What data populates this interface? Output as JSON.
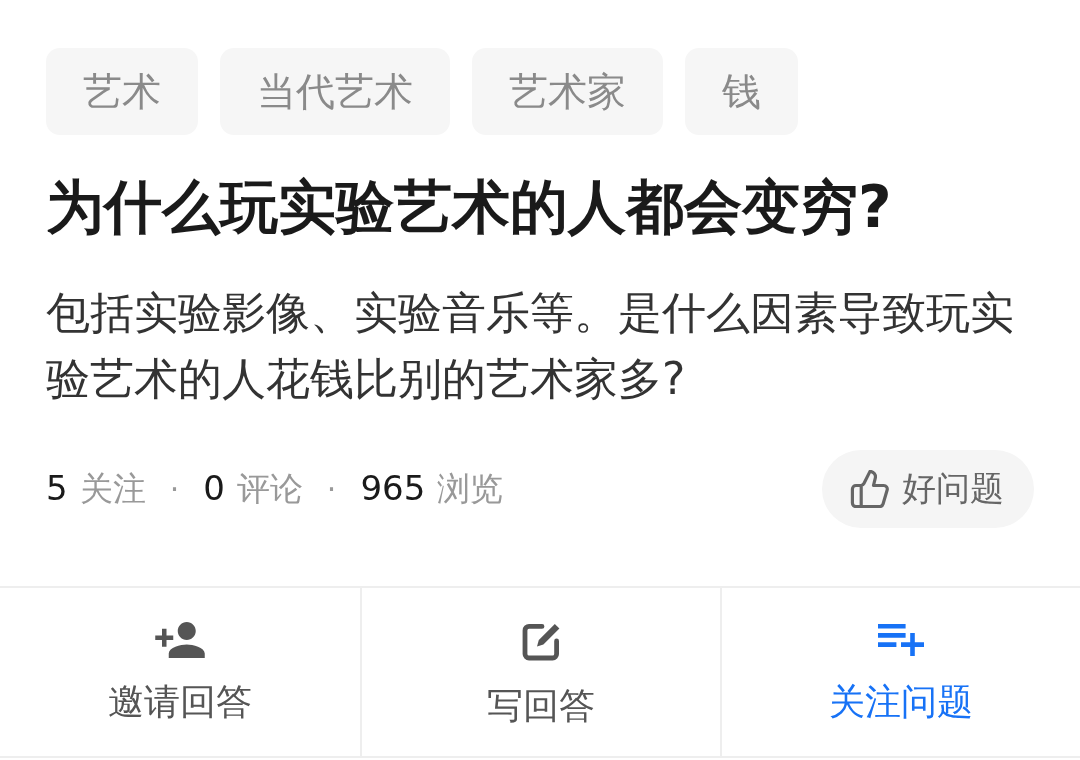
{
  "tags": [
    {
      "label": "艺术"
    },
    {
      "label": "当代艺术"
    },
    {
      "label": "艺术家"
    },
    {
      "label": "钱"
    }
  ],
  "question": {
    "title": "为什么玩实验艺术的人都会变穷?",
    "description": "包括实验影像、实验音乐等。是什么因素导致玩实验艺术的人花钱比别的艺术家多?"
  },
  "stats": [
    {
      "count": "5",
      "label": "关注"
    },
    {
      "count": "0",
      "label": "评论"
    },
    {
      "count": "965",
      "label": "浏览"
    }
  ],
  "separators": [
    "·",
    "·"
  ],
  "good_question_button": {
    "label": "好问题"
  },
  "actions": [
    {
      "kind": "invite",
      "label": "邀请回答",
      "primary": false
    },
    {
      "kind": "write",
      "label": "写回答",
      "primary": false
    },
    {
      "kind": "follow",
      "label": "关注问题",
      "primary": true
    }
  ]
}
